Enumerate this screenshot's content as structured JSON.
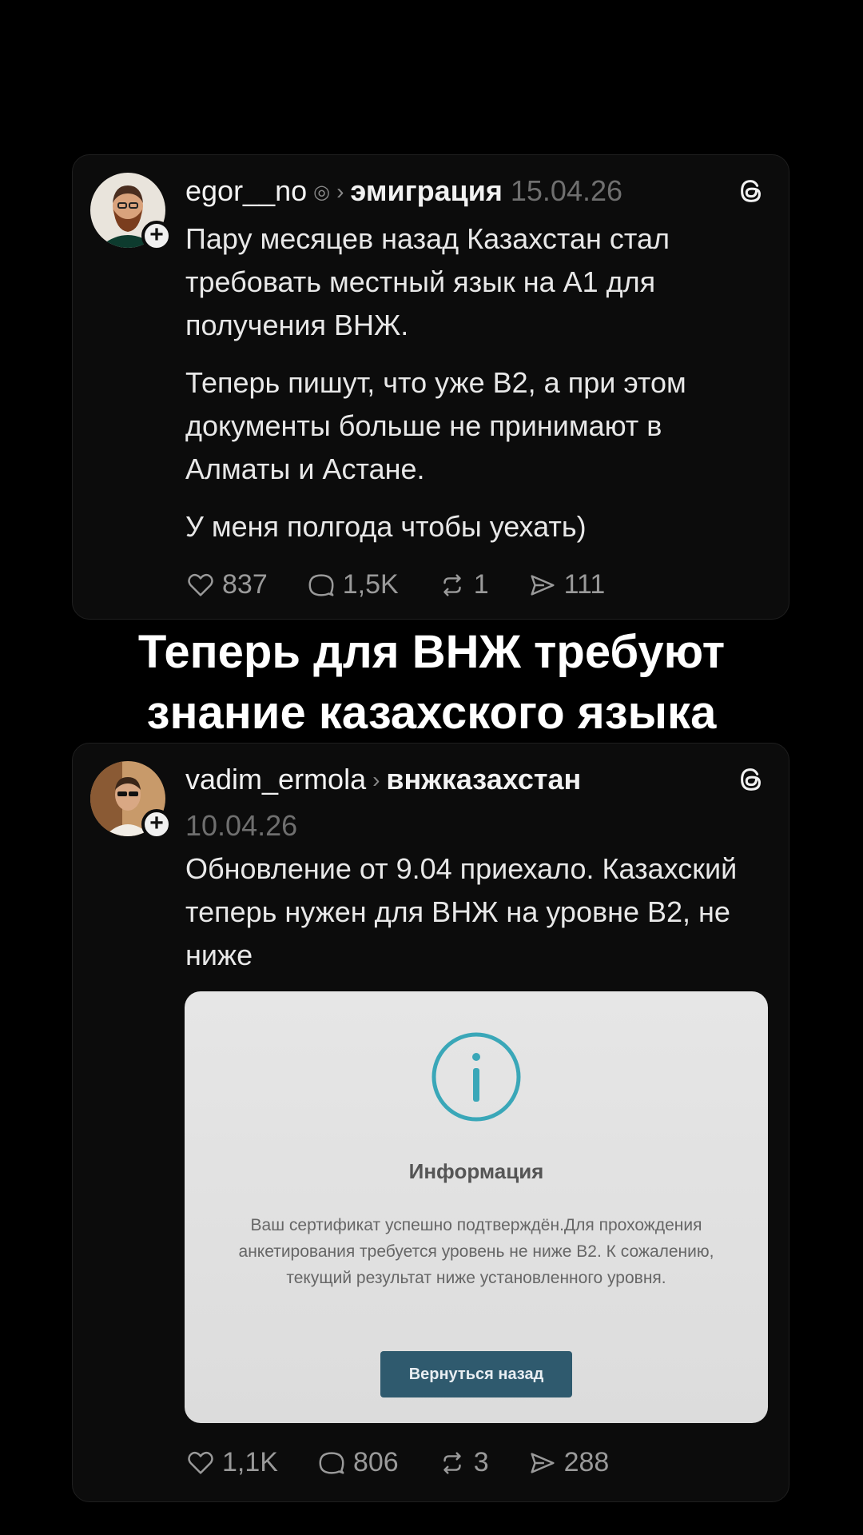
{
  "headline": {
    "line1": "Теперь для ВНЖ требуют",
    "line2": "знание казахского языка"
  },
  "post1": {
    "username": "egor__no",
    "topic": "эмиграция",
    "date": "15.04.26",
    "paragraphs": [
      "Пару месяцев назад Казахстан стал требовать местный язык на А1 для получения ВНЖ.",
      "Теперь пишут, что уже В2, а при этом документы больше не принимают в Алматы и Астане.",
      "У меня полгода чтобы уехать)"
    ],
    "likes": "837",
    "comments": "1,5K",
    "reposts": "1",
    "shares": "111"
  },
  "post2": {
    "username": "vadim_ermola",
    "topic": "внжказахстан",
    "date": "10.04.26",
    "text": "Обновление от 9.04 приехало. Казахский теперь нужен для ВНЖ на уровне В2, не ниже",
    "likes": "1,1K",
    "comments": "806",
    "reposts": "3",
    "shares": "288",
    "attachment": {
      "title": "Информация",
      "body": "Ваш сертификат успешно подтверждён.Для прохождения анкетирования требуется уровень не ниже B2. К сожалению, текущий результат ниже установленного уровня.",
      "button_label": "Вернуться назад"
    }
  },
  "icons": {
    "verified": "verified-badge-icon",
    "separator": "chevron-right-icon",
    "threads": "threads-logo-icon",
    "like": "heart-icon",
    "comment": "comment-bubble-icon",
    "repost": "repost-icon",
    "share": "send-icon",
    "info": "info-circle-icon",
    "follow": "plus-icon"
  },
  "colors": {
    "background": "#000000",
    "card": "#0c0c0c",
    "muted": "#9a9a9a",
    "info_accent": "#3aa7b8",
    "button": "#2f5a6e"
  }
}
